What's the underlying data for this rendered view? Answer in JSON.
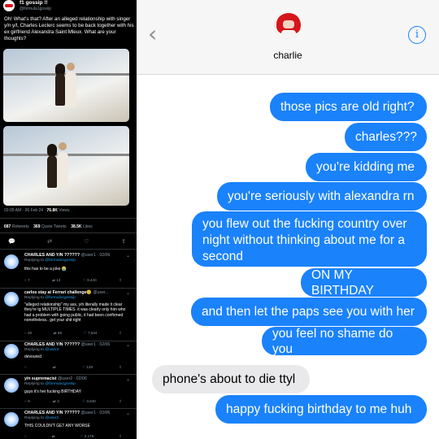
{
  "twitter": {
    "account_name": "f1 gossip !!",
    "account_handle": "@formula1gossip",
    "caption": "Oh! What's that? After an alleged relationship with singer y/n y/l, Charles Leclerc seems to be back together with his ex girlfriend Alexandra Saint Mleux. What are your thoughts?",
    "meta_time": "03:05 AM · 06 Feb 24 ·",
    "meta_views_count": "76.8K",
    "meta_views_label": "Views",
    "retweets_count": "687",
    "retweets_label": "Retweets",
    "quotes_count": "369",
    "quotes_label": "Quote Tweets",
    "likes_count": "38.5K",
    "likes_label": "Likes",
    "action_icons": [
      "reply-icon",
      "retweet-icon",
      "like-icon",
      "share-icon"
    ],
    "replies": [
      {
        "name": "CHARLES AND Y/N ??????",
        "sub": "@user1 · 02/06",
        "replying": "Replying to",
        "to": "@formula1gossip",
        "text": "this has to be a joke 😭",
        "stats": [
          "7",
          "13",
          "9,440",
          ""
        ]
      },
      {
        "name": "carlos stay at Ferrari challenge🥺",
        "sub": "@user...",
        "replying": "Replying to",
        "to": "@formula1gossip",
        "text": "\"alleged relationship\" my ass, y/n literally made it clear they're tg MULTIPLE TIMES. it was clearly only him who had a problem with going public, it had been confirmed nonetheless.. get your shit right",
        "stats": [
          "20",
          "68",
          "7,634",
          ""
        ]
      },
      {
        "name": "CHARLES AND Y/N ??????",
        "sub": "@user1 · 02/06",
        "replying": "Replying to",
        "to": "@user3",
        "text": "devoured",
        "stats": [
          "",
          "",
          "139",
          ""
        ]
      },
      {
        "name": "y/n supremacist",
        "sub": "@user2 · 02/06",
        "replying": "Replying to",
        "to": "@formula1gossip",
        "text": "guys it's her fucking BIRTHDAY",
        "stats": [
          "9",
          "3",
          "3,840",
          ""
        ]
      },
      {
        "name": "CHARLES AND Y/N ??????",
        "sub": "@user1 · 02/06",
        "replying": "Replying to",
        "to": "@user2",
        "text": "THIS COULDN'T GET ANY WORSE",
        "stats": [
          "",
          "",
          "2,176",
          ""
        ]
      }
    ]
  },
  "imessage": {
    "contact_name": "charlie",
    "back_icon": "chevron-left-icon",
    "info_icon": "info-icon",
    "info_glyph": "i",
    "accent": "#1a82fb",
    "incoming_color": "#e9e9eb",
    "messages": [
      {
        "dir": "out",
        "text": "those pics are old right?"
      },
      {
        "dir": "out",
        "text": "charles???"
      },
      {
        "dir": "out",
        "text": "you're kidding me"
      },
      {
        "dir": "out",
        "text": "you're seriously with alexandra rn"
      },
      {
        "dir": "out",
        "text": "you flew out the fucking country over night without thinking about me for a second"
      },
      {
        "dir": "out",
        "text": "ON MY BIRTHDAY"
      },
      {
        "dir": "out",
        "text": "and then let the paps see you with her"
      },
      {
        "dir": "out",
        "text": "you feel no shame do you"
      },
      {
        "dir": "in",
        "text": "phone's about to die ttyl"
      },
      {
        "dir": "out",
        "text": "happy fucking birthday to me huh"
      }
    ]
  }
}
